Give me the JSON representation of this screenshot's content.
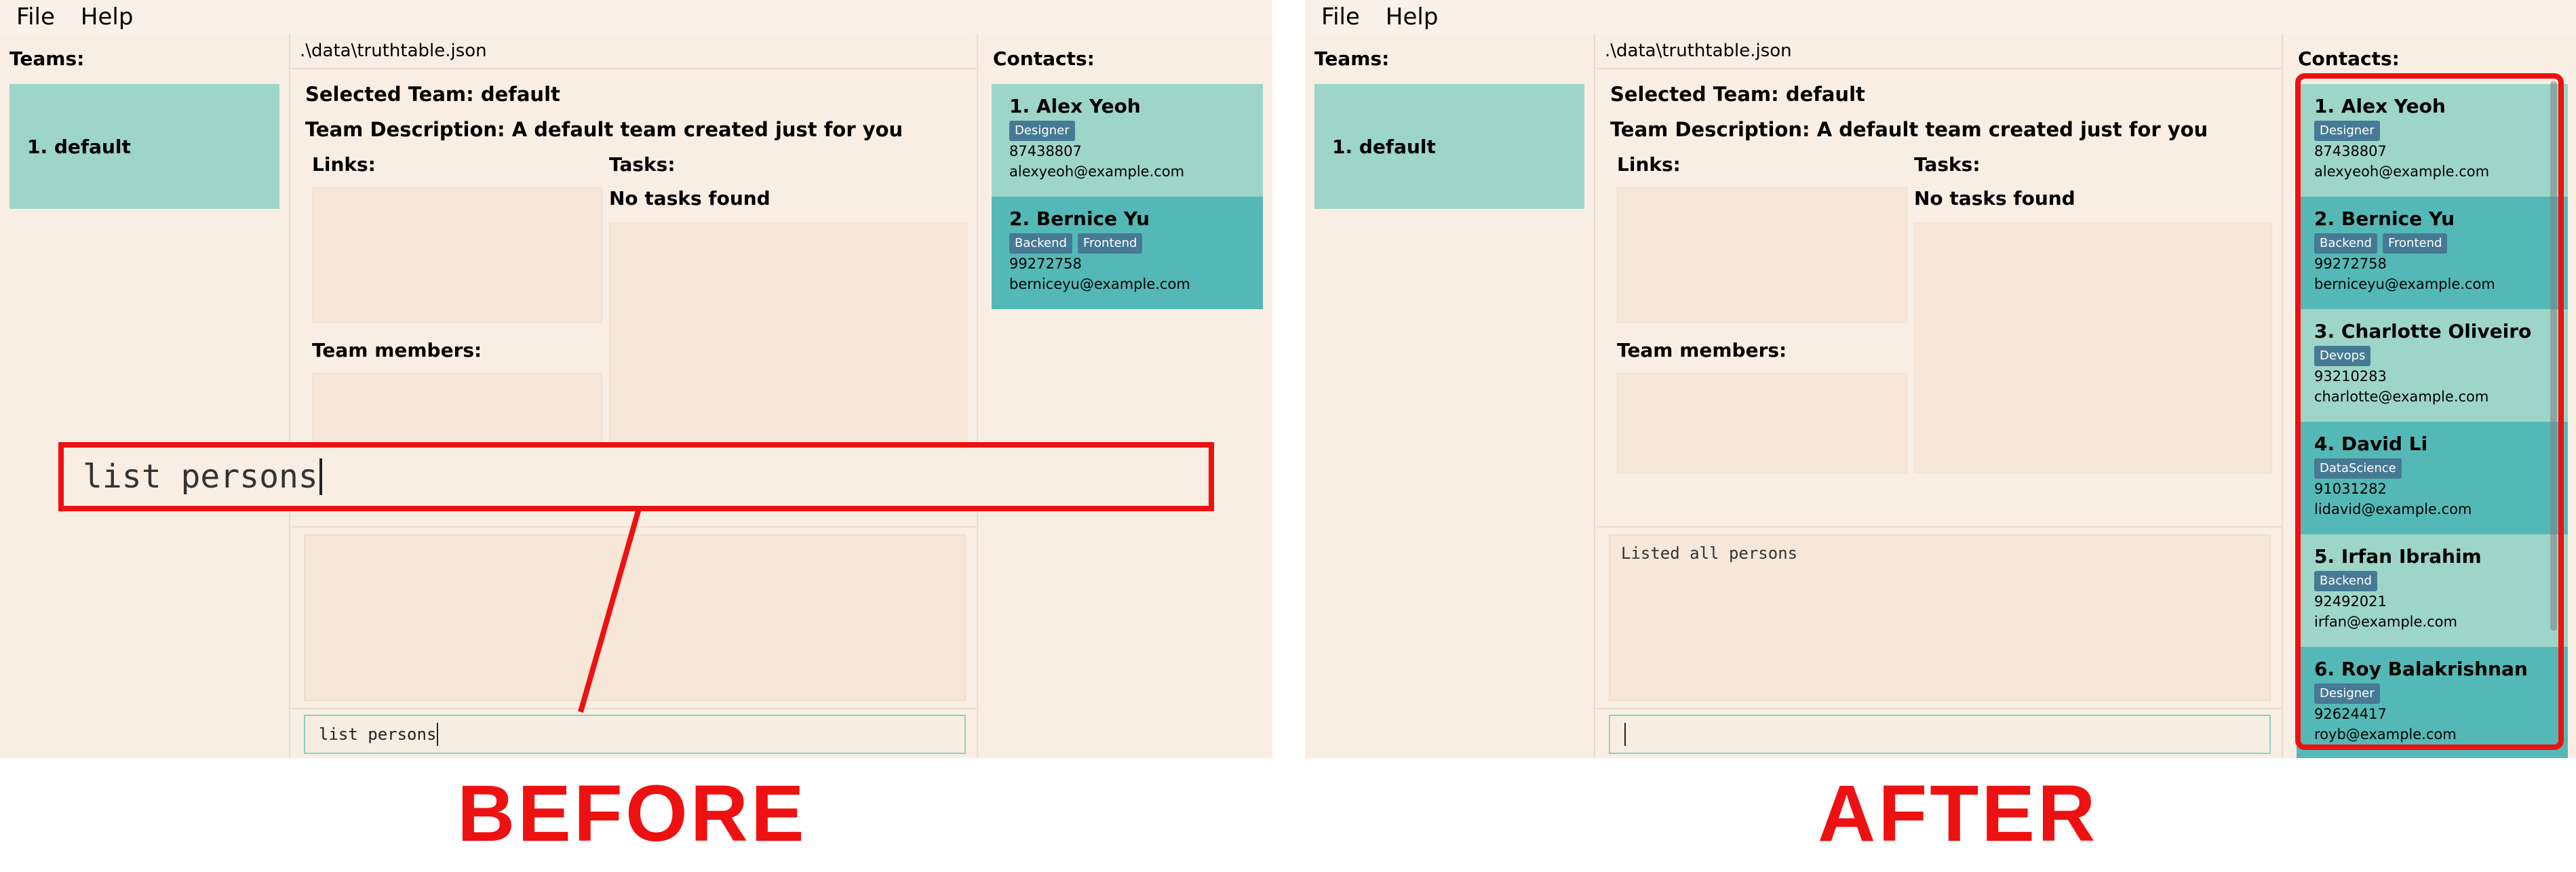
{
  "menu": {
    "file": "File",
    "help": "Help"
  },
  "teams_header": "Teams:",
  "teams": [
    {
      "label": "1. default"
    }
  ],
  "file_path": ".\\data\\truthtable.json",
  "selected_team": "Selected Team: default",
  "team_description": "Team Description: A default team created just for you",
  "links_label": "Links:",
  "tasks_label": "Tasks:",
  "no_tasks": "No tasks found",
  "team_members_label": "Team members:",
  "contacts_header": "Contacts:",
  "before": {
    "command_input": "list persons",
    "result_text": "",
    "callout_text": "list persons",
    "persons": [
      {
        "name": "1. Alex Yeoh",
        "tags": [
          "Designer"
        ],
        "phone": "87438807",
        "email": "alexyeoh@example.com"
      },
      {
        "name": "2. Bernice Yu",
        "tags": [
          "Backend",
          "Frontend"
        ],
        "phone": "99272758",
        "email": "berniceyu@example.com"
      }
    ]
  },
  "after": {
    "command_input": "",
    "result_text": "Listed all persons",
    "persons": [
      {
        "name": "1. Alex Yeoh",
        "tags": [
          "Designer"
        ],
        "phone": "87438807",
        "email": "alexyeoh@example.com"
      },
      {
        "name": "2. Bernice Yu",
        "tags": [
          "Backend",
          "Frontend"
        ],
        "phone": "99272758",
        "email": "berniceyu@example.com"
      },
      {
        "name": "3. Charlotte Oliveiro",
        "tags": [
          "Devops"
        ],
        "phone": "93210283",
        "email": "charlotte@example.com"
      },
      {
        "name": "4. David Li",
        "tags": [
          "DataScience"
        ],
        "phone": "91031282",
        "email": "lidavid@example.com"
      },
      {
        "name": "5. Irfan Ibrahim",
        "tags": [
          "Backend"
        ],
        "phone": "92492021",
        "email": "irfan@example.com"
      },
      {
        "name": "6. Roy Balakrishnan",
        "tags": [
          "Designer"
        ],
        "phone": "92624417",
        "email": "royb@example.com"
      }
    ]
  },
  "captions": {
    "before": "BEFORE",
    "after": "AFTER"
  },
  "colors": {
    "annotation_red": "#ee1111",
    "card_light": "#9dd5c8",
    "card_dark": "#54b9b6",
    "tag_bg": "#467a94",
    "window_bg": "#f8eee4"
  }
}
